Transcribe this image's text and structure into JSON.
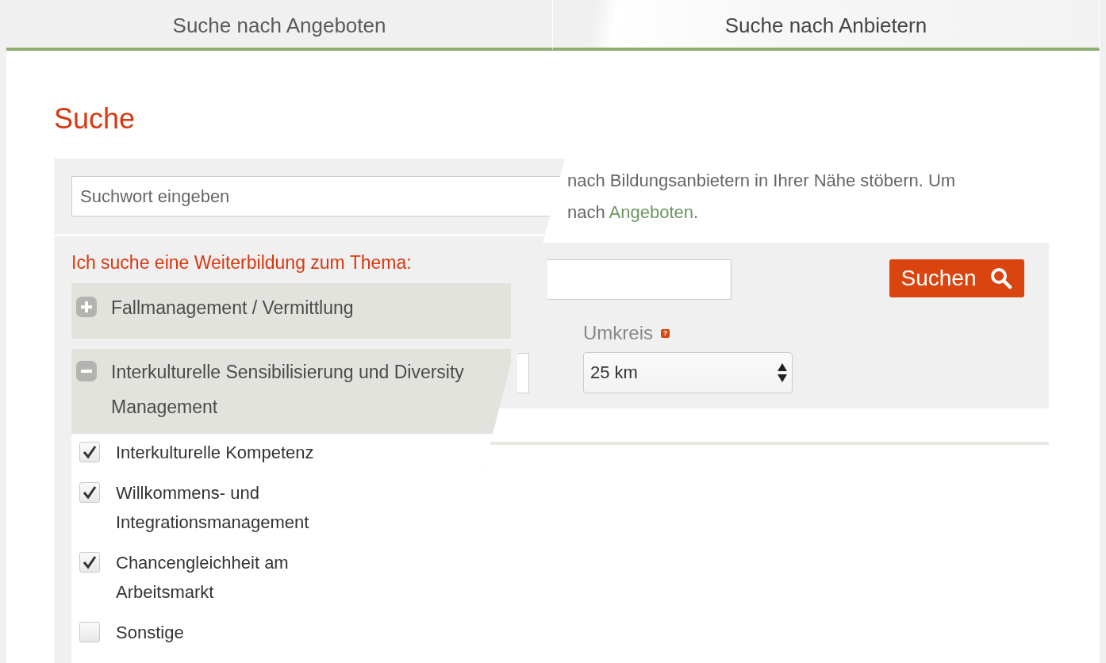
{
  "tabs": [
    {
      "label": "Suche nach Angeboten",
      "selected": false
    },
    {
      "label": "Suche nach Anbietern",
      "selected": true
    }
  ],
  "heading": "Suche",
  "intro": {
    "line_1": "nach Bildungsanbietern in Ihrer Nähe stöbern. Um",
    "line_2_text": "nach ",
    "line_2_link": "Angeboten",
    "line_2_end": "."
  },
  "search_form": {
    "button": "Suchen",
    "radius_label": "Umkreis",
    "radius_help": "?",
    "radius_value": "25 km"
  },
  "overlay": {
    "search": {
      "placeholder": "Suchwort eingeben"
    },
    "topic_heading": "Ich suche eine Weiterbildung zum Thema:",
    "topics": [
      {
        "label": "Fallmanagement / Vermittlung",
        "expanded": false
      },
      {
        "label": "Interkulturelle Sensibilisierung und Diversity Management",
        "expanded": true,
        "children": [
          {
            "label": "Interkulturelle Kompetenz",
            "checked": true
          },
          {
            "label": "Willkommens- und Integrationsmanagement",
            "checked": true
          },
          {
            "label": "Chancengleichheit am Arbeitsmarkt",
            "checked": true
          },
          {
            "label": "Sonstige",
            "checked": false
          }
        ]
      }
    ]
  }
}
